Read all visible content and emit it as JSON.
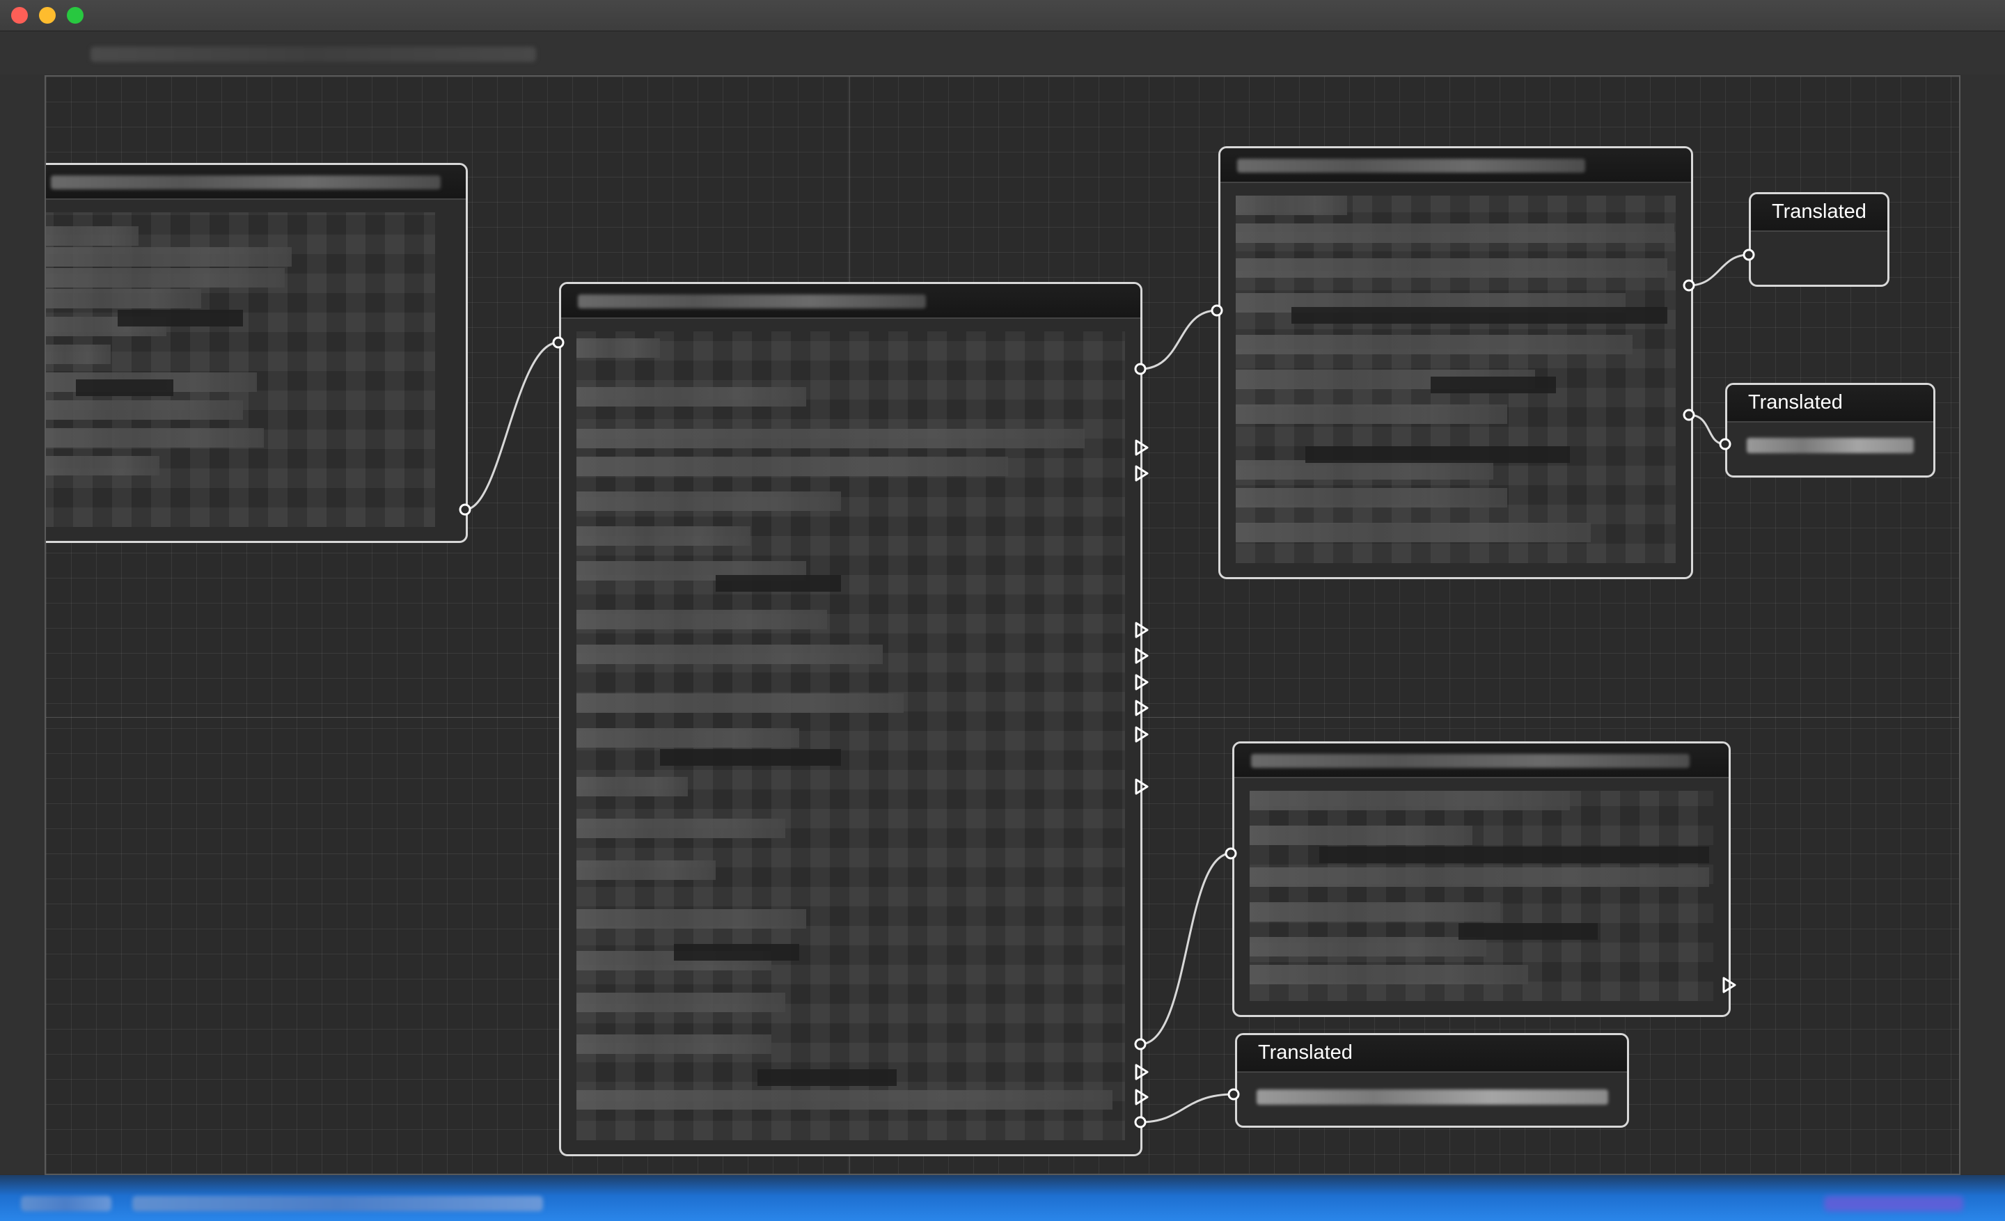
{
  "window": {
    "controls": [
      "close",
      "minimize",
      "zoom"
    ]
  },
  "canvas": {
    "nodes": [
      {
        "id": "node-a",
        "title": ""
      },
      {
        "id": "node-b",
        "title": ""
      },
      {
        "id": "node-c",
        "title": ""
      },
      {
        "id": "node-d",
        "title": ""
      },
      {
        "id": "node-translated-1",
        "title": "Translated"
      },
      {
        "id": "node-translated-2",
        "title": "Translated"
      },
      {
        "id": "node-translated-3",
        "title": "Translated"
      }
    ]
  },
  "colors": {
    "canvas_bg": "#2b2b2b",
    "node_border": "#d8d8d8",
    "status_bar": "#1e6fd0"
  }
}
